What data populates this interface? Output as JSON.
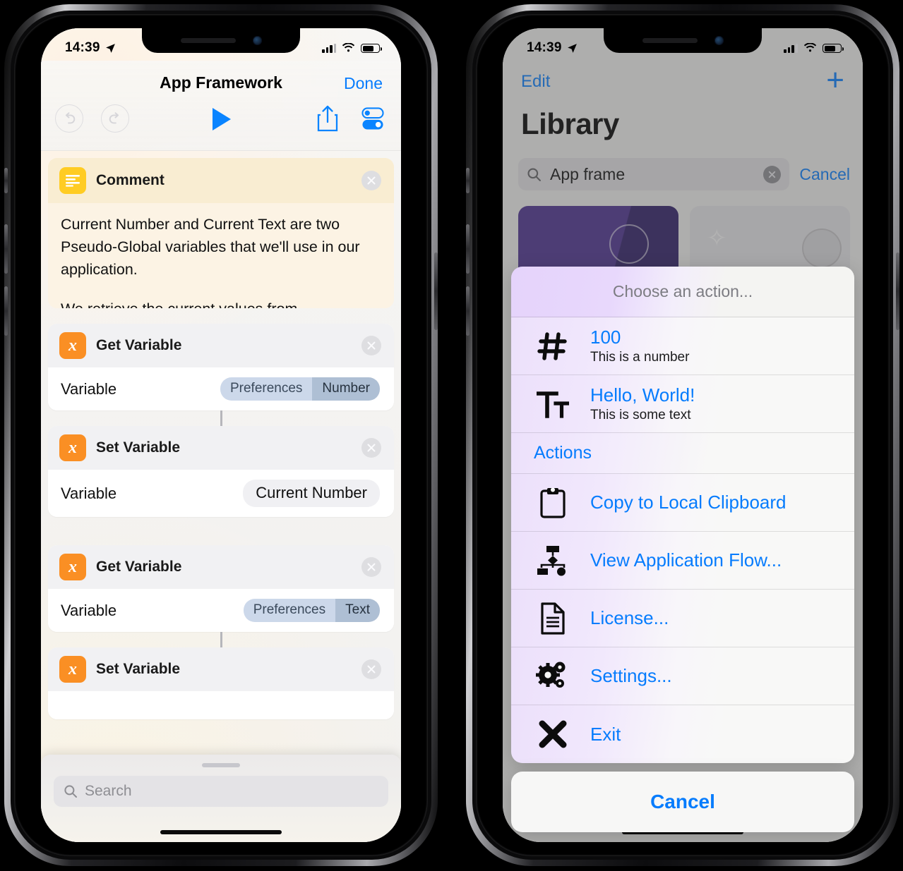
{
  "status_bar": {
    "time": "14:39",
    "location_icon": "location-arrow-icon"
  },
  "left_phone": {
    "navbar": {
      "title": "App Framework",
      "done_label": "Done"
    },
    "toolbar": {
      "undo": "undo-icon",
      "redo": "redo-icon",
      "run": "play-icon",
      "share": "share-icon",
      "settings": "toggles-icon"
    },
    "comment": {
      "header_label": "Comment",
      "paragraph_1": "Current Number and Current Text are two Pseudo-Global variables that we'll use in our application.",
      "paragraph_2": "We retrieve the current values from Preferences. They will be displayed and"
    },
    "actions": [
      {
        "title": "Get Variable",
        "row_label": "Variable",
        "value_kind": "split",
        "value_a": "Preferences",
        "value_b": "Number"
      },
      {
        "title": "Set Variable",
        "row_label": "Variable",
        "value_kind": "plain",
        "value": "Current Number"
      },
      {
        "title": "Get Variable",
        "row_label": "Variable",
        "value_kind": "split",
        "value_a": "Preferences",
        "value_b": "Text"
      },
      {
        "title": "Set Variable",
        "row_label": "Variable",
        "value_kind": "none",
        "value": ""
      }
    ],
    "bottom_sheet": {
      "search_placeholder": "Search"
    }
  },
  "right_phone": {
    "navbar": {
      "edit_label": "Edit",
      "add_label": "+"
    },
    "page_title": "Library",
    "search": {
      "value": "App frame",
      "cancel_label": "Cancel",
      "clear_icon": "clear-circle-icon"
    },
    "result_cards": [
      {
        "name": "purple-shortcut-card",
        "color": "#4a2f8f"
      },
      {
        "name": "grey-shortcut-card",
        "color": "#e6e5e8"
      }
    ],
    "action_sheet": {
      "title": "Choose an action...",
      "values": [
        {
          "icon": "hash-icon",
          "title": "100",
          "subtitle": "This is a number"
        },
        {
          "icon": "text-size-icon",
          "title": "Hello, World!",
          "subtitle": "This is some text"
        }
      ],
      "section_header": "Actions",
      "items": [
        {
          "icon": "clipboard-icon",
          "label": "Copy to Local Clipboard"
        },
        {
          "icon": "flowchart-icon",
          "label": "View Application Flow..."
        },
        {
          "icon": "document-icon",
          "label": "License..."
        },
        {
          "icon": "gears-icon",
          "label": "Settings..."
        },
        {
          "icon": "x-mark-icon",
          "label": "Exit"
        }
      ],
      "cancel_label": "Cancel"
    }
  },
  "colors": {
    "accent_blue": "#067cfd",
    "icon_orange": "#fa8f24",
    "icon_yellow": "#ffcc23",
    "card_purple": "#4a2f8f"
  }
}
